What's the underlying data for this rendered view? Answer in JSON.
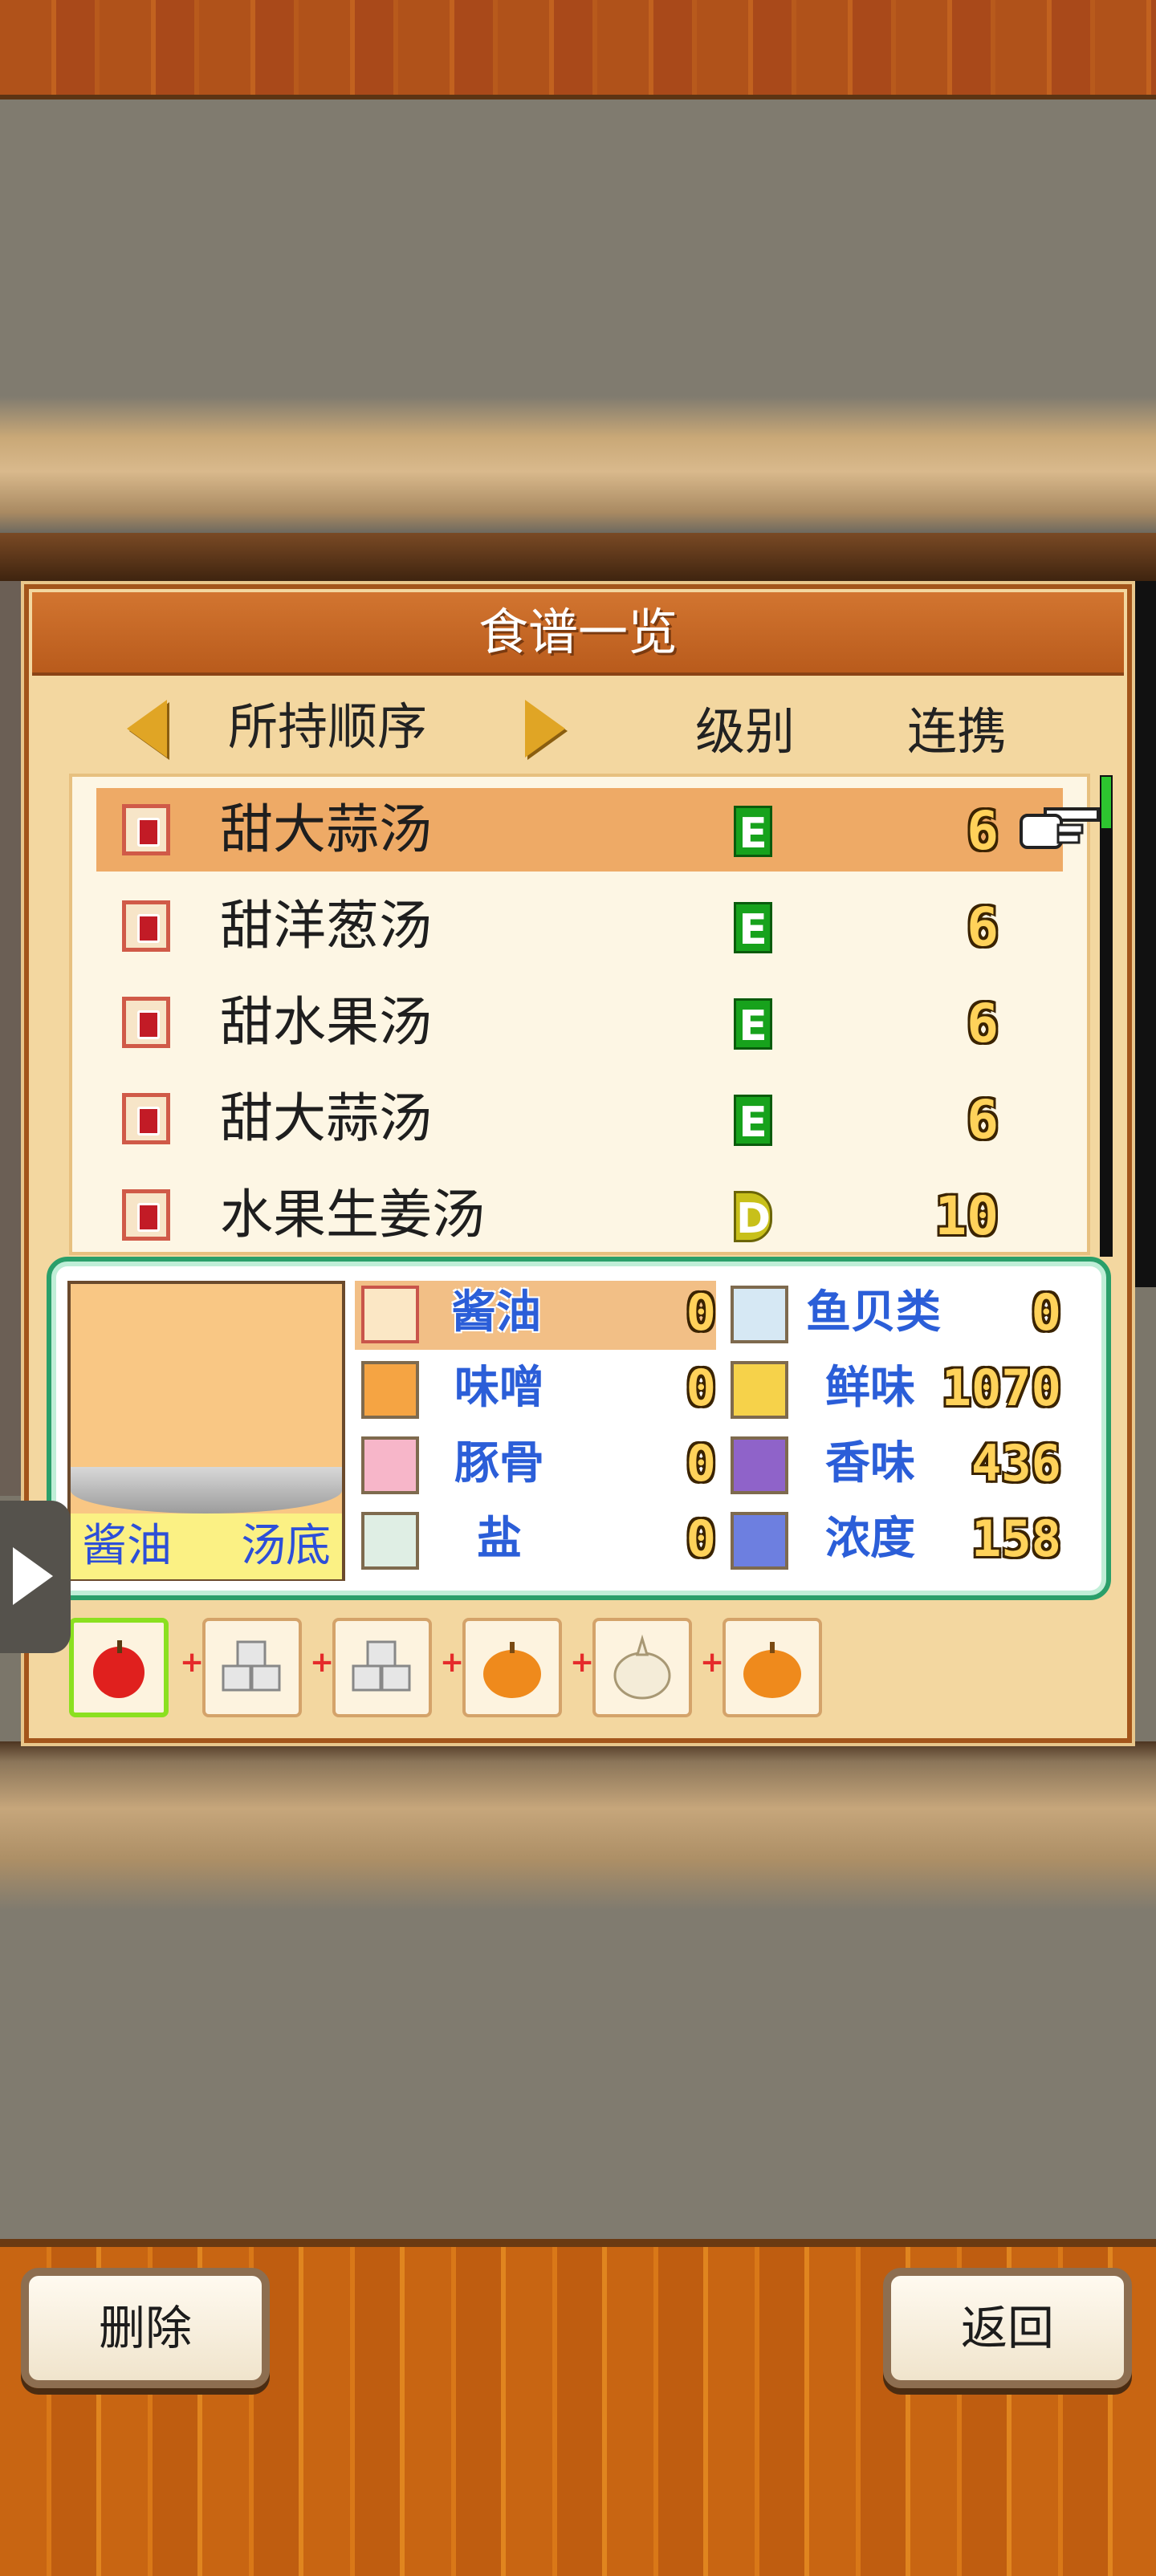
{
  "panel": {
    "title": "食谱一览",
    "sort_label": "所持顺序",
    "col_rank": "级别",
    "col_combo": "连携"
  },
  "recipes": [
    {
      "name": "甜大蒜汤",
      "rank": "E",
      "combo": "6",
      "selected": true
    },
    {
      "name": "甜洋葱汤",
      "rank": "E",
      "combo": "6"
    },
    {
      "name": "甜水果汤",
      "rank": "E",
      "combo": "6"
    },
    {
      "name": "甜大蒜汤",
      "rank": "E",
      "combo": "6"
    },
    {
      "name": "水果生姜汤",
      "rank": "D",
      "combo": "10"
    }
  ],
  "detail": {
    "base_name": "酱油",
    "base_type": "汤底",
    "stats_left": [
      {
        "label": "酱油",
        "value": "0",
        "icon": "soy-sauce-icon"
      },
      {
        "label": "味噌",
        "value": "0",
        "icon": "miso-icon"
      },
      {
        "label": "豚骨",
        "value": "0",
        "icon": "pork-bone-icon"
      },
      {
        "label": "盐",
        "value": "0",
        "icon": "salt-icon"
      }
    ],
    "stats_right": [
      {
        "label": "鱼贝类",
        "value": "0",
        "icon": "seafood-icon"
      },
      {
        "label": "鲜味",
        "value": "1070",
        "icon": "umami-icon"
      },
      {
        "label": "香味",
        "value": "436",
        "icon": "aroma-icon"
      },
      {
        "label": "浓度",
        "value": "158",
        "icon": "thickness-icon"
      }
    ]
  },
  "ingredients": [
    "apple-icon",
    "sugar-cube-icon",
    "sugar-cube-icon",
    "onion-icon",
    "garlic-icon",
    "onion-icon"
  ],
  "buttons": {
    "delete": "删除",
    "back": "返回"
  },
  "colors": {
    "selected_row": "#eeaa66",
    "rank_e": "#17a21c",
    "rank_d": "#c8c01a",
    "stat_label": "#2b5ed8"
  }
}
